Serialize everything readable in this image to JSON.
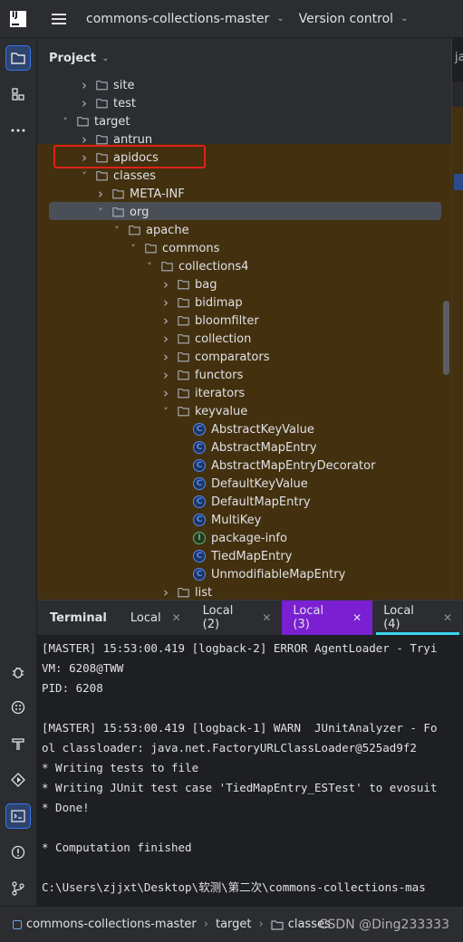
{
  "topbar": {
    "logo": "IJ",
    "project_menu": "commons-collections-master",
    "vcs_menu": "Version control"
  },
  "project_panel": {
    "title": "Project",
    "tree": [
      {
        "label": "site",
        "depth": 2,
        "type": "folder",
        "expanded": false
      },
      {
        "label": "test",
        "depth": 2,
        "type": "folder",
        "expanded": false
      },
      {
        "label": "target",
        "depth": 1,
        "type": "folder",
        "expanded": true
      },
      {
        "label": "antrun",
        "depth": 2,
        "type": "folder",
        "expanded": false
      },
      {
        "label": "apidocs",
        "depth": 2,
        "type": "folder",
        "expanded": false
      },
      {
        "label": "classes",
        "depth": 2,
        "type": "folder",
        "expanded": true,
        "selected": true
      },
      {
        "label": "META-INF",
        "depth": 3,
        "type": "folder",
        "expanded": false
      },
      {
        "label": "org",
        "depth": 3,
        "type": "folder",
        "expanded": true
      },
      {
        "label": "apache",
        "depth": 4,
        "type": "folder",
        "expanded": true
      },
      {
        "label": "commons",
        "depth": 5,
        "type": "folder",
        "expanded": true
      },
      {
        "label": "collections4",
        "depth": 6,
        "type": "folder",
        "expanded": true
      },
      {
        "label": "bag",
        "depth": 7,
        "type": "folder",
        "expanded": false
      },
      {
        "label": "bidimap",
        "depth": 7,
        "type": "folder",
        "expanded": false
      },
      {
        "label": "bloomfilter",
        "depth": 7,
        "type": "folder",
        "expanded": false
      },
      {
        "label": "collection",
        "depth": 7,
        "type": "folder",
        "expanded": false
      },
      {
        "label": "comparators",
        "depth": 7,
        "type": "folder",
        "expanded": false
      },
      {
        "label": "functors",
        "depth": 7,
        "type": "folder",
        "expanded": false
      },
      {
        "label": "iterators",
        "depth": 7,
        "type": "folder",
        "expanded": false
      },
      {
        "label": "keyvalue",
        "depth": 7,
        "type": "folder",
        "expanded": true
      },
      {
        "label": "AbstractKeyValue",
        "depth": 8,
        "type": "class"
      },
      {
        "label": "AbstractMapEntry",
        "depth": 8,
        "type": "class"
      },
      {
        "label": "AbstractMapEntryDecorator",
        "depth": 8,
        "type": "class"
      },
      {
        "label": "DefaultKeyValue",
        "depth": 8,
        "type": "class"
      },
      {
        "label": "DefaultMapEntry",
        "depth": 8,
        "type": "class"
      },
      {
        "label": "MultiKey",
        "depth": 8,
        "type": "class"
      },
      {
        "label": "package-info",
        "depth": 8,
        "type": "interface"
      },
      {
        "label": "TiedMapEntry",
        "depth": 8,
        "type": "class"
      },
      {
        "label": "UnmodifiableMapEntry",
        "depth": 8,
        "type": "class"
      },
      {
        "label": "list",
        "depth": 7,
        "type": "folder",
        "expanded": false
      }
    ]
  },
  "editor": {
    "tab_fragment": "ja"
  },
  "terminal": {
    "title": "Terminal",
    "tabs": [
      {
        "label": "Local",
        "style": "normal"
      },
      {
        "label": "Local (2)",
        "style": "normal"
      },
      {
        "label": "Local (3)",
        "style": "purple"
      },
      {
        "label": "Local (4)",
        "style": "active"
      }
    ],
    "lines": [
      "[MASTER] 15:53:00.419 [logback-2] ERROR AgentLoader - Tryi",
      "VM: 6208@TWW",
      "PID: 6208",
      "",
      "[MASTER] 15:53:00.419 [logback-1] WARN  JUnitAnalyzer - Fo",
      "ol classloader: java.net.FactoryURLClassLoader@525ad9f2",
      "* Writing tests to file",
      "* Writing JUnit test case 'TiedMapEntry_ESTest' to evosuit",
      "* Done!",
      "",
      "* Computation finished",
      "",
      "C:\\Users\\zjjxt\\Desktop\\软测\\第二次\\commons-collections-mas"
    ]
  },
  "statusbar": {
    "crumbs": [
      "commons-collections-master",
      "target",
      "classes"
    ],
    "watermark": "CSDN @Ding233333"
  },
  "colors": {
    "accent": "#3574f0",
    "highlight_box": "#e0211b",
    "excluded_bg": "#43300f",
    "purple_tab": "#7a1fd1"
  }
}
